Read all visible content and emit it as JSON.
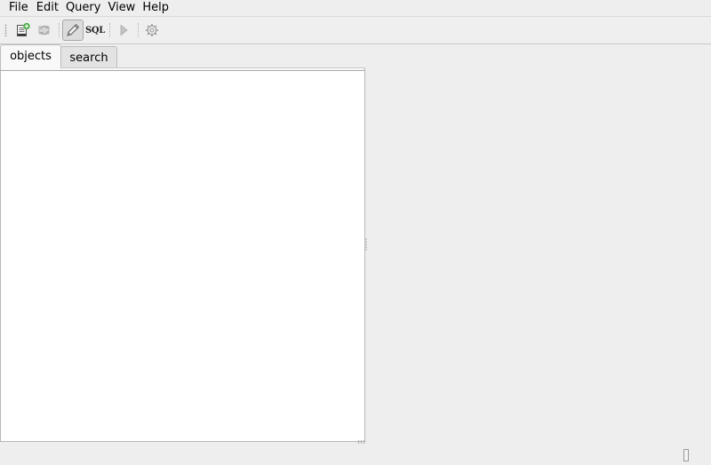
{
  "menubar": {
    "items": [
      {
        "label": "File"
      },
      {
        "label": "Edit"
      },
      {
        "label": "Query"
      },
      {
        "label": "View"
      },
      {
        "label": "Help"
      }
    ]
  },
  "toolbar": {
    "buttons": [
      {
        "icon": "new-database-icon",
        "state": "normal"
      },
      {
        "icon": "refresh-icon",
        "state": "disabled"
      },
      {
        "icon": "edit-pencil-icon",
        "state": "pressed"
      },
      {
        "label": "SQL",
        "icon": "sql-icon",
        "state": "normal"
      },
      {
        "icon": "run-play-icon",
        "state": "disabled"
      },
      {
        "icon": "settings-gear-icon",
        "state": "disabled"
      }
    ]
  },
  "tabs": [
    {
      "label": "objects",
      "active": true
    },
    {
      "label": "search",
      "active": false
    }
  ],
  "colors": {
    "window_bg": "#eeeeee",
    "panel_bg": "#ffffff",
    "border": "#b7b7b7"
  }
}
